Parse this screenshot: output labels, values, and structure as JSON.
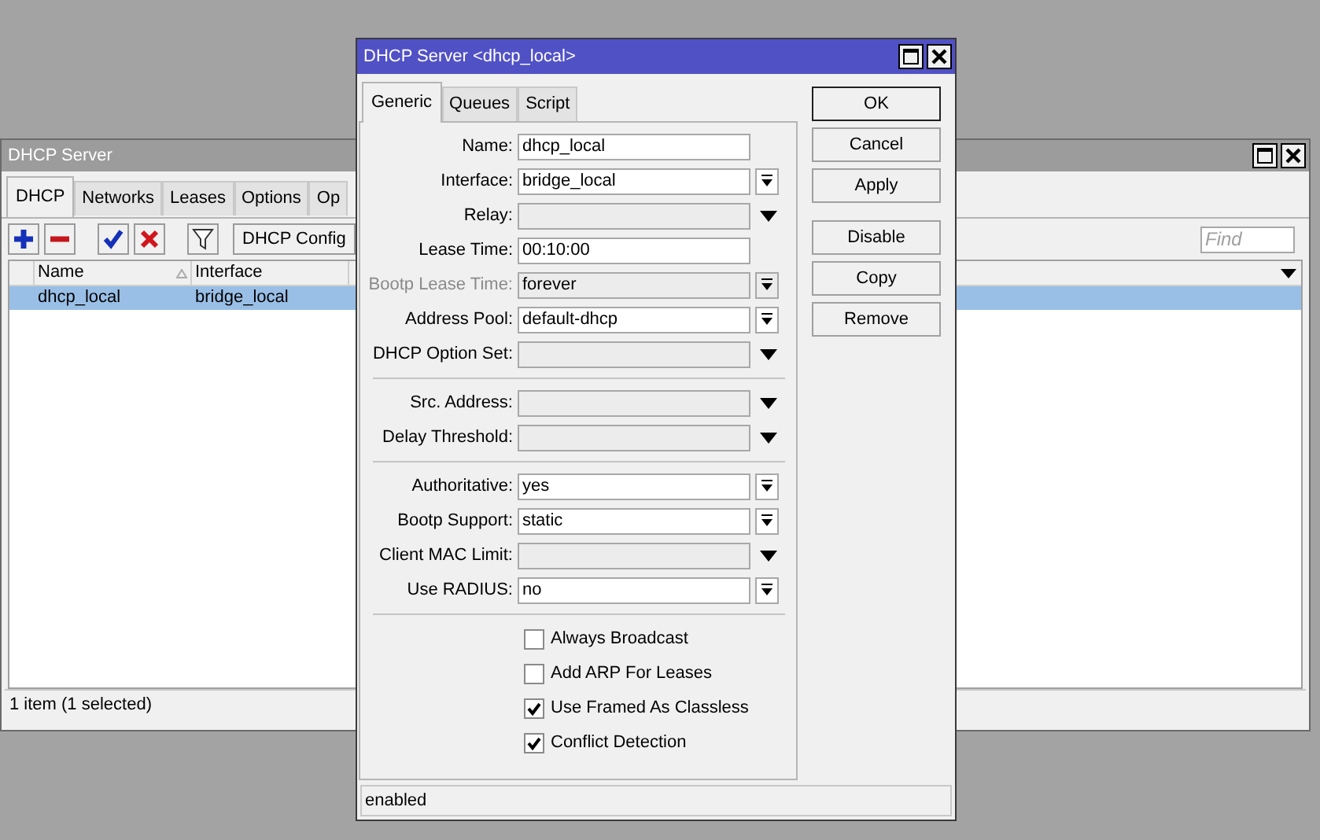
{
  "main_window": {
    "title": "DHCP Server",
    "tabs": [
      {
        "label": "DHCP",
        "selected": true
      },
      {
        "label": "Networks",
        "selected": false
      },
      {
        "label": "Leases",
        "selected": false
      },
      {
        "label": "Options",
        "selected": false
      },
      {
        "label": "Op",
        "selected": false
      }
    ],
    "toolbar": {
      "config_button": "DHCP Config",
      "find": {
        "placeholder": "Find"
      }
    },
    "table": {
      "columns": [
        {
          "label": "Name",
          "sorted": true
        },
        {
          "label": "Interface",
          "sorted": false
        }
      ],
      "rows": [
        {
          "cells": [
            "dhcp_local",
            "bridge_local"
          ],
          "selected": true
        }
      ]
    },
    "status_bar": "1 item (1 selected)"
  },
  "dialog": {
    "title": "DHCP Server <dhcp_local>",
    "tabs": [
      {
        "label": "Generic",
        "selected": true
      },
      {
        "label": "Queues",
        "selected": false
      },
      {
        "label": "Script",
        "selected": false
      }
    ],
    "sections": [
      {
        "fields": [
          {
            "label": "Name:",
            "value": "dhcp_local",
            "kind": "text",
            "disabled": false
          },
          {
            "label": "Interface:",
            "value": "bridge_local",
            "kind": "combo",
            "disabled": false
          },
          {
            "label": "Relay:",
            "kind": "dropdown",
            "disabled": false
          },
          {
            "label": "Lease Time:",
            "value": "00:10:00",
            "kind": "text",
            "disabled": false
          },
          {
            "label": "Bootp Lease Time:",
            "value": "forever",
            "kind": "combo",
            "disabled": true
          },
          {
            "label": "Address Pool:",
            "value": "default-dhcp",
            "kind": "combo",
            "disabled": false
          },
          {
            "label": "DHCP Option Set:",
            "kind": "dropdown",
            "disabled": false
          }
        ]
      },
      {
        "fields": [
          {
            "label": "Src. Address:",
            "kind": "dropdown",
            "disabled": false
          },
          {
            "label": "Delay Threshold:",
            "kind": "dropdown",
            "disabled": false
          }
        ]
      },
      {
        "fields": [
          {
            "label": "Authoritative:",
            "value": "yes",
            "kind": "combo",
            "disabled": false
          },
          {
            "label": "Bootp Support:",
            "value": "static",
            "kind": "combo",
            "disabled": false
          },
          {
            "label": "Client MAC Limit:",
            "kind": "dropdown",
            "disabled": false
          },
          {
            "label": "Use RADIUS:",
            "value": "no",
            "kind": "combo",
            "disabled": false
          }
        ]
      }
    ],
    "checkboxes": [
      {
        "label": "Always Broadcast",
        "checked": false
      },
      {
        "label": "Add ARP For Leases",
        "checked": false
      },
      {
        "label": "Use Framed As Classless",
        "checked": true
      },
      {
        "label": "Conflict Detection",
        "checked": true
      }
    ],
    "buttons": [
      {
        "label": "OK",
        "default": true
      },
      {
        "label": "Cancel",
        "default": false
      },
      {
        "label": "Apply",
        "default": false
      },
      {
        "label": "Disable",
        "default": false
      },
      {
        "label": "Copy",
        "default": false
      },
      {
        "label": "Remove",
        "default": false
      }
    ],
    "status_bar": "enabled"
  }
}
